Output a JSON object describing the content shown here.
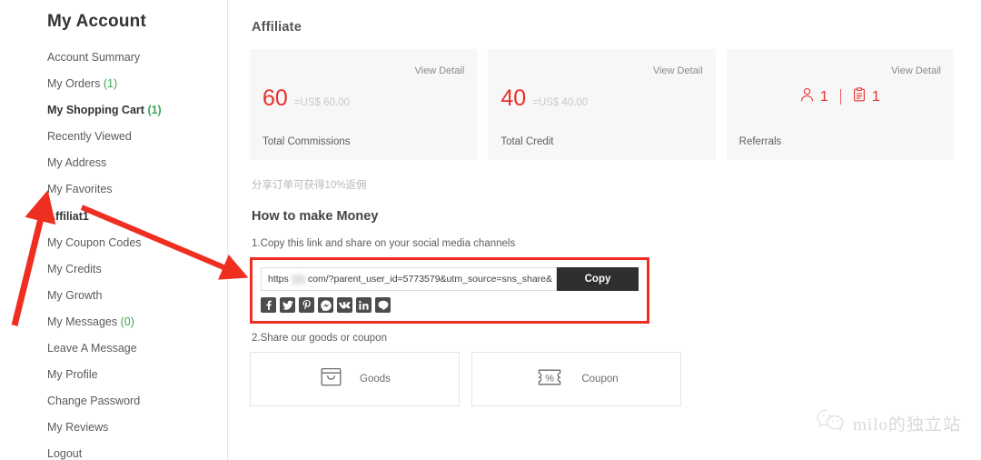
{
  "sidebar": {
    "title": "My Account",
    "items": [
      {
        "label": "Account Summary",
        "count": "",
        "bold": false
      },
      {
        "label": "My Orders",
        "count": "(1)",
        "bold": false
      },
      {
        "label": "My Shopping Cart",
        "count": "(1)",
        "bold": true
      },
      {
        "label": "Recently Viewed",
        "count": "",
        "bold": false
      },
      {
        "label": "My Address",
        "count": "",
        "bold": false
      },
      {
        "label": "My Favorites",
        "count": "",
        "bold": false
      },
      {
        "label": "Affiliat1",
        "count": "",
        "bold": true
      },
      {
        "label": "My Coupon Codes",
        "count": "",
        "bold": false
      },
      {
        "label": "My Credits",
        "count": "",
        "bold": false
      },
      {
        "label": "My Growth",
        "count": "",
        "bold": false
      },
      {
        "label": "My Messages",
        "count": "(0)",
        "bold": false
      },
      {
        "label": "Leave A Message",
        "count": "",
        "bold": false
      },
      {
        "label": "My Profile",
        "count": "",
        "bold": false
      },
      {
        "label": "Change Password",
        "count": "",
        "bold": false
      },
      {
        "label": "My Reviews",
        "count": "",
        "bold": false
      },
      {
        "label": "Logout",
        "count": "",
        "bold": false
      }
    ]
  },
  "main": {
    "heading": "Affiliate",
    "cards": [
      {
        "view_detail": "View Detail",
        "value": "60",
        "sub": "=US$ 60.00",
        "label": "Total Commissions"
      },
      {
        "view_detail": "View Detail",
        "value": "40",
        "sub": "=US$ 40.00",
        "label": "Total Credit"
      },
      {
        "view_detail": "View Detail",
        "people_count": "1",
        "orders_count": "1",
        "label": "Referrals"
      }
    ],
    "promo_note": "分享订单可获得10%返佣",
    "howto_heading": "How to make Money",
    "step_one": "1.Copy this link and share on your social media channels",
    "share": {
      "link_prefix": "https",
      "link_suffix": "com/?parent_user_id=5773579&utm_source=sns_share&",
      "copy_label": "Copy",
      "social": [
        {
          "name": "facebook-icon"
        },
        {
          "name": "twitter-icon"
        },
        {
          "name": "pinterest-icon"
        },
        {
          "name": "messenger-icon"
        },
        {
          "name": "vk-icon"
        },
        {
          "name": "linkedin-icon"
        },
        {
          "name": "line-icon"
        }
      ]
    },
    "step_two": "2.Share our goods or coupon",
    "share_cards": [
      {
        "label": "Goods",
        "icon": "shopping-bag-icon"
      },
      {
        "label": "Coupon",
        "icon": "percent-ticket-icon"
      }
    ]
  },
  "watermark": {
    "text": "milo的独立站",
    "icon": "wechat-icon"
  },
  "colors": {
    "accent_red": "#e8302c",
    "annotation_red": "#ef2e22",
    "card_bg": "#f7f7f7",
    "copy_button_bg": "#2f2f2f",
    "count_green": "#3aa655"
  }
}
